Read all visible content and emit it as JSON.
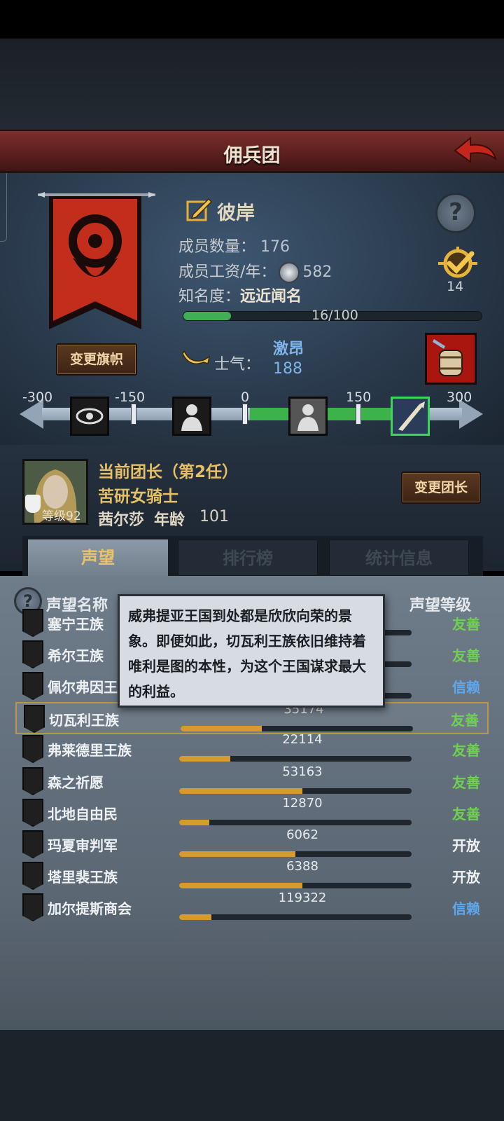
{
  "header": {
    "title": "佣兵团"
  },
  "guild": {
    "name": "彼岸",
    "members_label": "成员数量：",
    "members_value": "176",
    "salary_label": "成员工资/年：",
    "salary_value": "582",
    "fame_label": "知名度：",
    "fame_value": "远近闻名",
    "fame_progress_text": "16/100",
    "fame_progress": 0.16,
    "achievement_count": "14",
    "change_flag_label": "变更旗帜"
  },
  "morale": {
    "label": "士气：",
    "state": "激昂",
    "value": "188",
    "scale_labels": [
      "-300",
      "-150",
      "0",
      "150",
      "300"
    ]
  },
  "leader": {
    "title": "当前团长（第2任）",
    "class": "苦研女骑士",
    "name": "茜尔莎",
    "age_label": "年龄",
    "age_value": "101",
    "level": "等级92",
    "change_leader_label": "变更团长"
  },
  "tabs": [
    "声望",
    "排行榜",
    "统计信息"
  ],
  "reputation": {
    "col_name": "声望名称",
    "col_level": "声望等级",
    "tooltip": "威弗提亚王国到处都是欣欣向荣的景象。即便如此，切瓦利王族依旧维持着唯利是图的本性，为这个王国谋求最大的利益。",
    "rows": [
      {
        "name": "塞宁王族",
        "value": "",
        "progress": 0.0,
        "level": "友善",
        "level_color": "#6fd052"
      },
      {
        "name": "希尔王族",
        "value": "",
        "progress": 0.0,
        "level": "友善",
        "level_color": "#6fd052"
      },
      {
        "name": "佩尔弗因王",
        "value": "",
        "progress": 0.0,
        "level": "信赖",
        "level_color": "#5ea8f0"
      },
      {
        "name": "切瓦利王族",
        "value": "35174",
        "progress": 0.35,
        "level": "友善",
        "level_color": "#6fd052"
      },
      {
        "name": "弗莱德里王族",
        "value": "22114",
        "progress": 0.22,
        "level": "友善",
        "level_color": "#6fd052"
      },
      {
        "name": "森之祈愿",
        "value": "53163",
        "progress": 0.53,
        "level": "友善",
        "level_color": "#6fd052"
      },
      {
        "name": "北地自由民",
        "value": "12870",
        "progress": 0.13,
        "level": "友善",
        "level_color": "#6fd052"
      },
      {
        "name": "玛夏审判军",
        "value": "6062",
        "progress": 0.5,
        "level": "开放",
        "level_color": "#f0f2f4"
      },
      {
        "name": "塔里裴王族",
        "value": "6388",
        "progress": 0.53,
        "level": "开放",
        "level_color": "#f0f2f4"
      },
      {
        "name": "加尔提斯商会",
        "value": "119322",
        "progress": 0.14,
        "level": "信赖",
        "level_color": "#5ea8f0"
      }
    ]
  }
}
